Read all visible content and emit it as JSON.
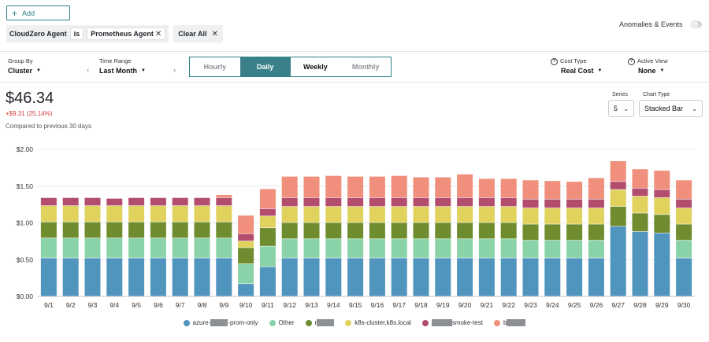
{
  "toolbar": {
    "add_label": "Add",
    "anomalies_label": "Anomalies & Events"
  },
  "filter": {
    "field": "CloudZero Agent",
    "op": "is",
    "value": "Prometheus Agent",
    "clear_label": "Clear All"
  },
  "controls": {
    "group_by": {
      "label": "Group By",
      "value": "Cluster"
    },
    "time_range": {
      "label": "Time Range",
      "value": "Last Month"
    },
    "granularity": {
      "options": [
        "Hourly",
        "Daily",
        "Weekly",
        "Monthly"
      ],
      "selected": "Daily"
    },
    "cost_type": {
      "label": "Cost Type",
      "value": "Real Cost"
    },
    "active_view": {
      "label": "Active View",
      "value": "None"
    }
  },
  "summary": {
    "total": "$46.34",
    "delta": "+$9.31 (25.14%)",
    "compare": "Compared to previous 30 days"
  },
  "chart_options": {
    "series_label": "Series",
    "series_value": "5",
    "type_label": "Chart Type",
    "type_value": "Stacked Bar"
  },
  "legend": {
    "items": [
      {
        "prefix": "azure-",
        "suffix": "-prom-only",
        "color": "#4f95be",
        "redact_w": 22
      },
      {
        "prefix": "Other",
        "suffix": "",
        "color": "#8ad3a8",
        "redact_w": 0
      },
      {
        "prefix": "r",
        "suffix": "",
        "color": "#6f8c2e",
        "redact_w": 22
      },
      {
        "prefix": "k8s-cluster.k8s.local",
        "suffix": "",
        "color": "#e0d25d",
        "redact_w": 0
      },
      {
        "prefix": "",
        "suffix": "smoke-test",
        "color": "#b34d6e",
        "redact_w": 26
      },
      {
        "prefix": "b",
        "suffix": "",
        "color": "#f0907c",
        "redact_w": 24
      }
    ]
  },
  "chart_data": {
    "type": "bar",
    "stacked": true,
    "categories": [
      "9/1",
      "9/2",
      "9/3",
      "9/4",
      "9/5",
      "9/6",
      "9/7",
      "9/8",
      "9/9",
      "9/10",
      "9/11",
      "9/12",
      "9/13",
      "9/14",
      "9/15",
      "9/16",
      "9/17",
      "9/18",
      "9/19",
      "9/20",
      "9/21",
      "9/22",
      "9/23",
      "9/24",
      "9/25",
      "9/26",
      "9/27",
      "9/28",
      "9/29",
      "9/30"
    ],
    "ylim": [
      0,
      2
    ],
    "yticks": [
      "$0.00",
      "$0.50",
      "$1.00",
      "$1.50",
      "$2.00"
    ],
    "grid": true,
    "series": [
      {
        "name": "azure-prom-only",
        "color": "#4f95be",
        "values": [
          0.52,
          0.52,
          0.52,
          0.52,
          0.52,
          0.52,
          0.52,
          0.52,
          0.52,
          0.17,
          0.4,
          0.52,
          0.52,
          0.52,
          0.52,
          0.52,
          0.52,
          0.52,
          0.52,
          0.52,
          0.52,
          0.52,
          0.52,
          0.52,
          0.52,
          0.52,
          0.95,
          0.88,
          0.86,
          0.52
        ]
      },
      {
        "name": "Other",
        "color": "#8ad3a8",
        "values": [
          0.27,
          0.27,
          0.27,
          0.27,
          0.27,
          0.27,
          0.27,
          0.27,
          0.27,
          0.27,
          0.28,
          0.26,
          0.26,
          0.26,
          0.26,
          0.26,
          0.26,
          0.26,
          0.26,
          0.26,
          0.26,
          0.26,
          0.24,
          0.24,
          0.24,
          0.24,
          0.0,
          0.0,
          0.0,
          0.24
        ]
      },
      {
        "name": "r",
        "color": "#6f8c2e",
        "values": [
          0.22,
          0.22,
          0.22,
          0.22,
          0.22,
          0.22,
          0.22,
          0.22,
          0.22,
          0.22,
          0.25,
          0.22,
          0.22,
          0.22,
          0.22,
          0.22,
          0.22,
          0.22,
          0.22,
          0.22,
          0.22,
          0.22,
          0.22,
          0.22,
          0.22,
          0.22,
          0.27,
          0.25,
          0.25,
          0.22
        ]
      },
      {
        "name": "k8s-cluster.k8s.local",
        "color": "#e0d25d",
        "values": [
          0.22,
          0.22,
          0.22,
          0.22,
          0.22,
          0.22,
          0.22,
          0.22,
          0.22,
          0.09,
          0.16,
          0.22,
          0.22,
          0.22,
          0.22,
          0.22,
          0.22,
          0.22,
          0.22,
          0.22,
          0.22,
          0.22,
          0.22,
          0.22,
          0.22,
          0.22,
          0.23,
          0.23,
          0.23,
          0.22
        ]
      },
      {
        "name": "smoke-test",
        "color": "#b34d6e",
        "values": [
          0.11,
          0.11,
          0.11,
          0.1,
          0.11,
          0.11,
          0.11,
          0.11,
          0.11,
          0.1,
          0.1,
          0.12,
          0.12,
          0.12,
          0.12,
          0.12,
          0.12,
          0.12,
          0.12,
          0.12,
          0.12,
          0.12,
          0.12,
          0.12,
          0.12,
          0.12,
          0.11,
          0.11,
          0.11,
          0.12
        ]
      },
      {
        "name": "b",
        "color": "#f0907c",
        "values": [
          0.0,
          0.0,
          0.0,
          0.0,
          0.0,
          0.0,
          0.0,
          0.0,
          0.04,
          0.25,
          0.27,
          0.29,
          0.29,
          0.3,
          0.29,
          0.29,
          0.3,
          0.28,
          0.28,
          0.32,
          0.26,
          0.26,
          0.26,
          0.25,
          0.24,
          0.29,
          0.28,
          0.26,
          0.26,
          0.26
        ]
      }
    ]
  }
}
